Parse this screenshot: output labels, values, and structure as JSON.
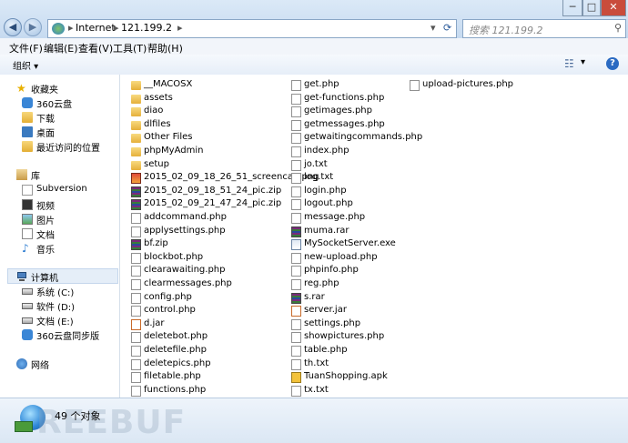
{
  "window": {
    "controls": {
      "minimize": "─",
      "maximize": "□",
      "close": "✕"
    },
    "back_icon": "back-arrow",
    "forward_icon": "forward-arrow"
  },
  "address_bar": {
    "segments": [
      "Internet",
      "121.199.2"
    ],
    "separator": "▸",
    "refresh_icon": "⟳",
    "dropdown": "▾"
  },
  "search": {
    "placeholder": "搜索 121.199.2"
  },
  "menu": [
    "文件(F)",
    "编辑(E)",
    "查看(V)",
    "工具(T)",
    "帮助(H)"
  ],
  "toolbar": {
    "organize_label": "组织 ▾",
    "view_icon": "☷",
    "view_dropdown": "▾",
    "help_icon": "?"
  },
  "sidebar": {
    "favorites": {
      "header": "收藏夹",
      "items": [
        "360云盘",
        "下载",
        "桌面",
        "最近访问的位置"
      ]
    },
    "libraries": {
      "header": "库",
      "items": [
        "Subversion",
        "视频",
        "图片",
        "文档",
        "音乐"
      ]
    },
    "computer": {
      "header": "计算机",
      "items": [
        "系统 (C:)",
        "软件 (D:)",
        "文档 (E:)",
        "360云盘同步版"
      ]
    },
    "network": {
      "header": "网络"
    }
  },
  "files": {
    "col1": [
      {
        "name": "__MACOSX",
        "type": "folder"
      },
      {
        "name": "assets",
        "type": "folder"
      },
      {
        "name": "diao",
        "type": "folder"
      },
      {
        "name": "dlfiles",
        "type": "folder"
      },
      {
        "name": "Other Files",
        "type": "folder"
      },
      {
        "name": "phpMyAdmin",
        "type": "folder"
      },
      {
        "name": "setup",
        "type": "folder"
      },
      {
        "name": "2015_02_09_18_26_51_screencap.png",
        "type": "png"
      },
      {
        "name": "2015_02_09_18_51_24_pic.zip",
        "type": "zip"
      },
      {
        "name": "2015_02_09_21_47_24_pic.zip",
        "type": "zip"
      },
      {
        "name": "addcommand.php",
        "type": "php"
      },
      {
        "name": "applysettings.php",
        "type": "php"
      },
      {
        "name": "bf.zip",
        "type": "zip"
      },
      {
        "name": "blockbot.php",
        "type": "php"
      },
      {
        "name": "clearawaiting.php",
        "type": "php"
      },
      {
        "name": "clearmessages.php",
        "type": "php"
      },
      {
        "name": "config.php",
        "type": "php"
      },
      {
        "name": "control.php",
        "type": "php"
      },
      {
        "name": "d.jar",
        "type": "jar"
      },
      {
        "name": "deletebot.php",
        "type": "php"
      },
      {
        "name": "deletefile.php",
        "type": "php"
      },
      {
        "name": "deletepics.php",
        "type": "php"
      },
      {
        "name": "filetable.php",
        "type": "php"
      },
      {
        "name": "functions.php",
        "type": "php"
      }
    ],
    "col2": [
      {
        "name": "get.php",
        "type": "php"
      },
      {
        "name": "get-functions.php",
        "type": "php"
      },
      {
        "name": "getimages.php",
        "type": "php"
      },
      {
        "name": "getmessages.php",
        "type": "php"
      },
      {
        "name": "getwaitingcommands.php",
        "type": "php"
      },
      {
        "name": "index.php",
        "type": "php"
      },
      {
        "name": "jo.txt",
        "type": "txt"
      },
      {
        "name": "log.txt",
        "type": "txt"
      },
      {
        "name": "login.php",
        "type": "php"
      },
      {
        "name": "logout.php",
        "type": "php"
      },
      {
        "name": "message.php",
        "type": "php"
      },
      {
        "name": "muma.rar",
        "type": "zip"
      },
      {
        "name": "MySocketServer.exe",
        "type": "exe"
      },
      {
        "name": "new-upload.php",
        "type": "php"
      },
      {
        "name": "phpinfo.php",
        "type": "php"
      },
      {
        "name": "reg.php",
        "type": "php"
      },
      {
        "name": "s.rar",
        "type": "zip"
      },
      {
        "name": "server.jar",
        "type": "jar"
      },
      {
        "name": "settings.php",
        "type": "php"
      },
      {
        "name": "showpictures.php",
        "type": "php"
      },
      {
        "name": "table.php",
        "type": "php"
      },
      {
        "name": "th.txt",
        "type": "txt"
      },
      {
        "name": "TuanShopping.apk",
        "type": "apk"
      },
      {
        "name": "tx.txt",
        "type": "txt"
      }
    ],
    "col3": [
      {
        "name": "upload-pictures.php",
        "type": "php"
      }
    ]
  },
  "status": {
    "count": "49 个对象",
    "watermark": "REEBUF"
  }
}
